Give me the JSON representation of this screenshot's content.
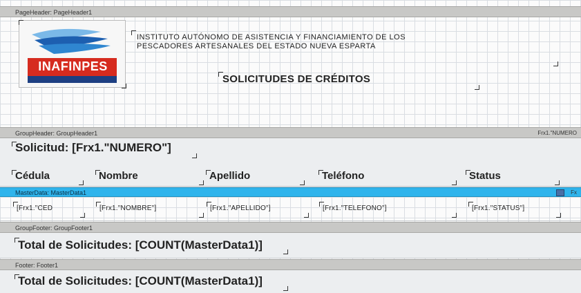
{
  "page_header": {
    "band_label": "PageHeader: PageHeader1",
    "logo_text": "INAFINPES",
    "institution_lines": [
      "INSTITUTO AUTÓNOMO DE ASISTENCIA Y FINANCIAMIENTO DE LOS",
      "PESCADORES ARTESANALES DEL ESTADO NUEVA ESPARTA"
    ],
    "report_title": "SOLICITUDES DE CRÉDITOS"
  },
  "group_header": {
    "band_label": "GroupHeader: GroupHeader1",
    "right_label": "Frx1.\"NUMERO",
    "solicitud_text": "Solicitud: [Frx1.\"NUMERO\"]",
    "columns": [
      "Cédula",
      "Nombre",
      "Apellido",
      "Teléfono",
      "Status"
    ]
  },
  "master_data": {
    "band_label": "MasterData: MasterData1",
    "right_label": "Fx",
    "fields": [
      "[Frx1.\"CED",
      "[Frx1.\"NOMBRE\"]",
      "[Frx1.\"APELLIDO\"]",
      "[Frx1.\"TELEFONO\"]",
      "[Frx1.\"STATUS\"]"
    ]
  },
  "group_footer": {
    "band_label": "GroupFooter: GroupFooter1",
    "total_text": "Total de Solicitudes: [COUNT(MasterData1)]"
  },
  "footer": {
    "band_label": "Footer: Footer1",
    "total_text": "Total de Solicitudes: [COUNT(MasterData1)]"
  },
  "colors": {
    "band_gray": "#c8c8c6",
    "band_blue": "#2fb4ec",
    "logo_red": "#d62b1f",
    "logo_blue": "#1d5fb0"
  }
}
